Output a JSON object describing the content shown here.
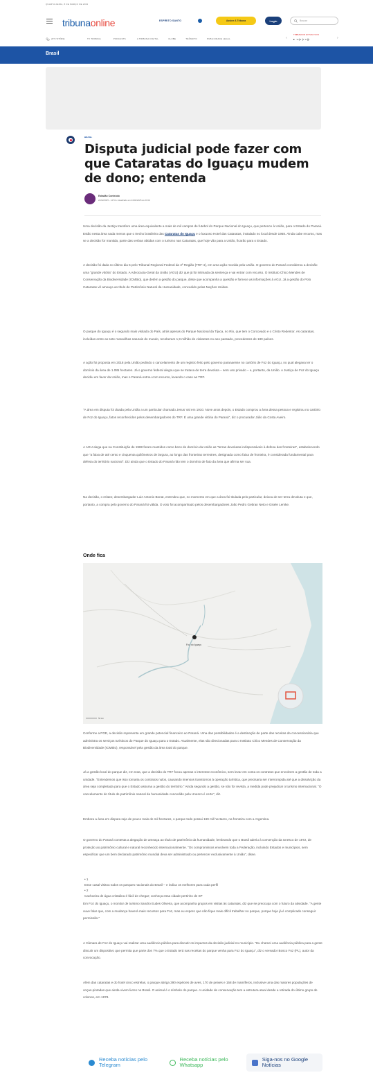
{
  "topbar": {
    "date": "QUARTA-FEIRA, 8 DE MARÇO DE 2023"
  },
  "header": {
    "logo_main": "tribuna",
    "logo_accent": "online",
    "espirito_label": "ESPÍRITO SANTO",
    "subscribe_label": "Assine A Tribuna",
    "login_label": "Login",
    "search_placeholder": "Buscar"
  },
  "nav": {
    "weather": "22°C VITÓRIA",
    "items": [
      "TV TRIBUNA",
      "PODCASTS",
      "A TRIBUNA DIGITAL",
      "CLUBE",
      "TRÂNSITO",
      "PUBLICIDADE LEGAL"
    ],
    "live_label": "TRIBUNA FM 107.5/AO VIVO",
    "live_wave": "▸ ·ıı|ıı·|ı·ıı||ı"
  },
  "section": {
    "title": "Brasil"
  },
  "article": {
    "kicker": "BRASIL",
    "title": "Disputa judicial pode fazer com que Cataratas do Iguaçu mudem de dono; entenda",
    "author": "Estadão Conteúdo",
    "dateline": "24/02/2025 - 14:53  •  Atualizado em 24/02/2025 às 20:04",
    "p1_a": "Uma decisão da Justiça transfere uma área equivalente a mais de mil campos de futebol do Parque Nacional do Iguaçu, que pertence à União, para o Estado do Paraná. Estão nesta área nada menos que o trecho brasileiro das ",
    "p1_link": "Cataratas do Iguaçu",
    "p1_b": " e o luxuoso Hotel das Cataratas, instalado no local desde 1958. Ainda cabe recurso, mas se a decisão for mantida, parte das verbas obtidas com o turismo nas Cataratas, que hoje vão para a União, ficarão para o Estado.",
    "p2": "A decisão foi dada no último dia 5 pelo Tribunal Regional Federal da 4ª Região (TRF-4), em uma ação movida pela União. O governo do Paraná considerou a decisão uma \"grande vitória\" do Estado. A Advocacia-Geral da União (AGU) diz que já foi intimada da sentença e vai entrar com recurso. O Instituto Chico Mendes de Conservação da Biodiversidade (ICMBio), que detém a gestão do parque, disse que acompanha a questão e fornece as informações à AGU. Já a gestão do Polo Cataratas vê ameaça ao título de Patrimônio Natural da Humanidade, concedido pelas Nações Unidas.",
    "p3": "O parque do Iguaçu é o segundo mais visitado do País, atrás apenas do Parque Nacional da Tijuca, no Rio, que tem o Corcovado e o Cristo Redentor. As cataratas, incluídas entre as sete maravilhas naturais do mundo, receberam 1,9 milhão de visitantes no ano passado, procedentes de 180 países.",
    "p4": "A ação foi proposta em 2018 pela União pedindo o cancelamento de um registro feito pelo governo paranaense no cartório de Foz do Iguaçu, no qual alegava ter o domínio da área de 1.085 hectares. Já o governo federal alegou que se tratava de terra devoluta – sem uso privado – e, portanto, da União. A Justiça de Foz do Iguaçu decidiu em favor da União, mas o Paraná entrou com recurso, levando o caso ao TRF.",
    "p5": "\"A área em disputa foi doada pela União a um particular chamado Jesus Val em 1910. Nove anos depois, o Estado comprou a área dessa pessoa e registrou no cartório de Foz do Iguaçu, fatos reconhecidos pelos desembargadores do TRF. É uma grande vitória do Paraná\", diz o procurador Júlio da Costa Aveiro.",
    "p6": "A AGU alega que na Constituição de 1988 foram mantidos como bens de domínio da União as \"terras devolutas indispensáveis à defesa das fronteiras\", estabelecendo que \"a faixa de até cento e cinquenta quilômetros de largura, ao longo das fronteiras terrestres, designada como faixa de fronteira, é considerada fundamental para defesa do território nacional\". Diz ainda que o Estado do Paraná não tem o domínio de fato da área que afirma ser sua.",
    "p7": "Na decisão, o relator, desembargador Luiz Antonio Bonat, entendeu que, no momento em que a área foi titulada pelo particular, deixou de ser terra devoluta e que, portanto, a compra pelo governo do Paraná foi válida. O voto foi acompanhado pelos desembargadores João Pedro Gebran Neto e Gisele Lemke.",
    "subhead": "Onde fica",
    "map_label": "Foz do Iguaçu",
    "map_scale": "50 km",
    "p8": "Conforme a PGE, a decisão representa um grande potencial financeiro ao Paraná. Uma das possibilidades é a destinação de parte das receitas da concessionária que administra os serviços turísticos do Parque do Iguaçu para o Estado. Atualmente, elas são direcionadas para o Instituto Chico Mendes de Conservação da Biodiversidade (ICMBio), responsável pela gestão da área total do parque.",
    "p9": "Já a gestão local do parque diz, em nota, que a decisão do TRF focou apenas o interesse econômico, sem levar em conta os contratos que envolvem a gestão de toda a unidade. \"Entendemos que isso tornaria os contratos nulos, causando imensos transtornos à operação turística, que precisaria ser interrompida até que a dissolvição da área seja completada para que o Estado assuma a gestão do território.\" Ainda segundo a gestão, se não for revista, a medida pode prejudicar o turismo internacional. \"O cancelamento do título de patrimônio natural da humanidade concedido pela Unesco é certo\", diz.",
    "p10": "Embora a área em disputa seja de pouco mais de mil hectares, o parque todo possui 169 mil hectares, na fronteira com a Argentina.",
    "p11": "O governo do Paraná contesta a alegação de ameaça ao título de patrimônio da humanidade, lembrando que o Brasil aderiu à convenção da Unesco de 1972, de proteção ao patrimônio cultural e natural reconhecido internacionalmente. \"Os compromissos envolvem toda a Federação, incluindo Estados e municípios, sem especificar que um bem declarado patrimônio mundial deva ser administrado ou pertencer exclusivamente à União\", disse.",
    "related": [
      {
        "num": "1",
        "text": "Esse casal visitou todos os parques nacionais do Brasil – e indica os melhores para cada perfil"
      },
      {
        "num": "2",
        "text": "Cachoeira de água cristalina é fácil de chegar; conheça essa cidade pertinho de SP"
      }
    ],
    "p12": "Em Foz do Iguaçu, o monitor de turismo Sandro Eudes Oliveira, que acompanha grupos em visitas às cataratas, diz que se preocupa com o futuro da atividade. \"A gente ouve falar que, com a mudança haverá mais recursos para Foz, mas eu espero que não fique mais difícil trabalhar no parque, porque hoje já é complicado conseguir permissão.\"",
    "p13": "A Câmara de Foz do Iguaçu vai realizar uma audiência pública para discutir os impactos da decisão judicial no município. \"Eu chamei uma audiência pública para a gente discutir um dispositivo que permita que parte dos 7% que o Estado terá nas receitas do parque venha para Foz do Iguaçu\", diz o vereador Bosco Foz (PL), autor da convocação.",
    "p14": "Além das cataratas e do hotel cinco estrelas, o parque abriga 390 espécies de aves, 170 de peixes e 158 de mamíferos, inclusive uma das maiores populações de onças-pintadas que ainda vivem livres no Brasil. O animal é o símbolo do parque. A unidade de conservação tem a estrutura atual desde a retirada do último grupo de colonos, em 1978."
  },
  "footer": {
    "telegram_label": "Receba notícias pelo Telegram",
    "whatsapp_label": "Receba notícias pelo Whatsapp",
    "google_label": "Siga-nos no Google Notícias"
  },
  "colors": {
    "brand_blue": "#1d54a5",
    "accent_yellow": "#f5c916",
    "logo_red": "#e6453a"
  }
}
